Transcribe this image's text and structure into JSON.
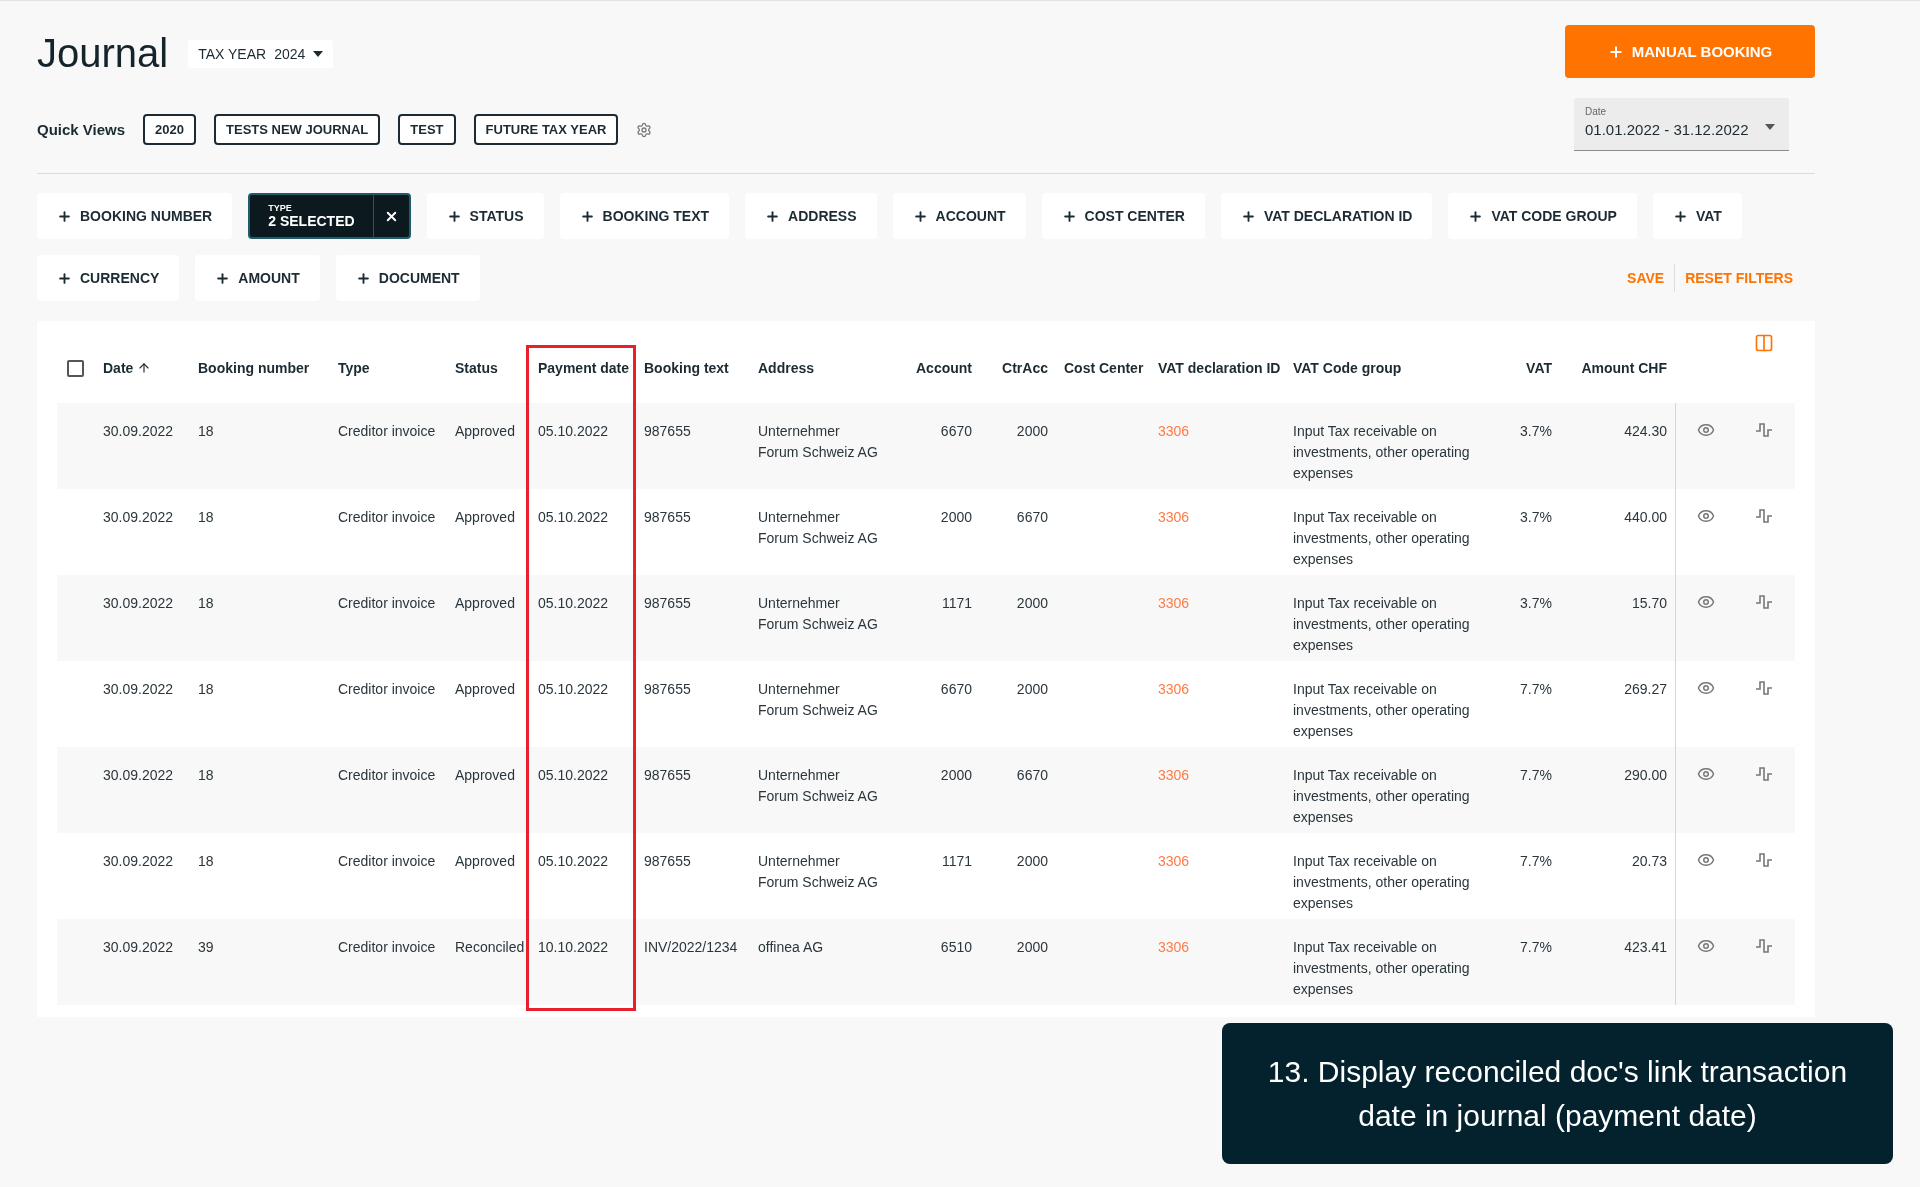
{
  "header": {
    "title": "Journal",
    "tax_year_label": "TAX YEAR",
    "tax_year": "2024",
    "action": "MANUAL BOOKING"
  },
  "quick_views": {
    "label": "Quick Views",
    "items": [
      "2020",
      "TESTS NEW JOURNAL",
      "TEST",
      "FUTURE TAX YEAR"
    ]
  },
  "date_filter": {
    "label": "Date",
    "value": "01.01.2022 - 31.12.2022"
  },
  "filters": [
    {
      "kind": "add",
      "label": "BOOKING NUMBER"
    },
    {
      "kind": "active",
      "caption": "TYPE",
      "label": "2 SELECTED"
    },
    {
      "kind": "add",
      "label": "STATUS"
    },
    {
      "kind": "add",
      "label": "BOOKING TEXT"
    },
    {
      "kind": "add",
      "label": "ADDRESS"
    },
    {
      "kind": "add",
      "label": "ACCOUNT"
    },
    {
      "kind": "add",
      "label": "COST CENTER"
    },
    {
      "kind": "add",
      "label": "VAT DECLARATION ID"
    },
    {
      "kind": "add",
      "label": "VAT CODE GROUP"
    },
    {
      "kind": "add",
      "label": "VAT"
    },
    {
      "kind": "add",
      "label": "CURRENCY"
    },
    {
      "kind": "add",
      "label": "AMOUNT"
    },
    {
      "kind": "add",
      "label": "DOCUMENT"
    }
  ],
  "filter_actions": [
    "SAVE",
    "RESET FILTERS"
  ],
  "table": {
    "select_all_checked": false,
    "columns": [
      {
        "label": "Date",
        "sorted": true,
        "highlighted": false
      },
      {
        "label": "Booking number",
        "sorted": false,
        "highlighted": false
      },
      {
        "label": "Type",
        "sorted": false,
        "highlighted": false
      },
      {
        "label": "Status",
        "sorted": false,
        "highlighted": false
      },
      {
        "label": "Payment date",
        "sorted": false,
        "highlighted": true
      },
      {
        "label": "Booking text",
        "sorted": false,
        "highlighted": false
      },
      {
        "label": "Address",
        "sorted": false,
        "highlighted": false
      },
      {
        "label": "Account",
        "sorted": false,
        "highlighted": false
      },
      {
        "label": "CtrAcc",
        "sorted": false,
        "highlighted": false
      },
      {
        "label": "Cost Center",
        "sorted": false,
        "highlighted": false
      },
      {
        "label": "VAT declaration ID",
        "sorted": false,
        "highlighted": false
      },
      {
        "label": "VAT Code group",
        "sorted": false,
        "highlighted": false
      },
      {
        "label": "VAT",
        "sorted": false,
        "highlighted": false
      },
      {
        "label": "Amount CHF",
        "sorted": false,
        "highlighted": false
      }
    ],
    "rows": [
      {
        "date": "30.09.2022",
        "booking_number": "18",
        "type": "Creditor invoice",
        "status": "Approved",
        "payment_date": "05.10.2022",
        "booking_text": "987655",
        "address": "Unternehmer Forum Schweiz AG",
        "account": "6670",
        "ctr_acc": "2000",
        "vat_declaration_id": "3306",
        "vat_code_group": "Input Tax receivable on investments, other operating expenses",
        "vat": "3.7%",
        "amount": "424.30"
      },
      {
        "date": "30.09.2022",
        "booking_number": "18",
        "type": "Creditor invoice",
        "status": "Approved",
        "payment_date": "05.10.2022",
        "booking_text": "987655",
        "address": "Unternehmer Forum Schweiz AG",
        "account": "2000",
        "ctr_acc": "6670",
        "vat_declaration_id": "3306",
        "vat_code_group": "Input Tax receivable on investments, other operating expenses",
        "vat": "3.7%",
        "amount": "440.00"
      },
      {
        "date": "30.09.2022",
        "booking_number": "18",
        "type": "Creditor invoice",
        "status": "Approved",
        "payment_date": "05.10.2022",
        "booking_text": "987655",
        "address": "Unternehmer Forum Schweiz AG",
        "account": "1171",
        "ctr_acc": "2000",
        "vat_declaration_id": "3306",
        "vat_code_group": "Input Tax receivable on investments, other operating expenses",
        "vat": "3.7%",
        "amount": "15.70"
      },
      {
        "date": "30.09.2022",
        "booking_number": "18",
        "type": "Creditor invoice",
        "status": "Approved",
        "payment_date": "05.10.2022",
        "booking_text": "987655",
        "address": "Unternehmer Forum Schweiz AG",
        "account": "6670",
        "ctr_acc": "2000",
        "vat_declaration_id": "3306",
        "vat_code_group": "Input Tax receivable on investments, other operating expenses",
        "vat": "7.7%",
        "amount": "269.27"
      },
      {
        "date": "30.09.2022",
        "booking_number": "18",
        "type": "Creditor invoice",
        "status": "Approved",
        "payment_date": "05.10.2022",
        "booking_text": "987655",
        "address": "Unternehmer Forum Schweiz AG",
        "account": "2000",
        "ctr_acc": "6670",
        "vat_declaration_id": "3306",
        "vat_code_group": "Input Tax receivable on investments, other operating expenses",
        "vat": "7.7%",
        "amount": "290.00"
      },
      {
        "date": "30.09.2022",
        "booking_number": "18",
        "type": "Creditor invoice",
        "status": "Approved",
        "payment_date": "05.10.2022",
        "booking_text": "987655",
        "address": "Unternehmer Forum Schweiz AG",
        "account": "1171",
        "ctr_acc": "2000",
        "vat_declaration_id": "3306",
        "vat_code_group": "Input Tax receivable on investments, other operating expenses",
        "vat": "7.7%",
        "amount": "20.73"
      },
      {
        "date": "30.09.2022",
        "booking_number": "39",
        "type": "Creditor invoice",
        "status": "Reconciled",
        "payment_date": "10.10.2022",
        "booking_text": "INV/2022/1234",
        "address": "offinea AG",
        "account": "6510",
        "ctr_acc": "2000",
        "vat_declaration_id": "3306",
        "vat_code_group": "Input Tax receivable on investments, other operating expenses",
        "vat": "7.7%",
        "amount": "423.41"
      }
    ]
  },
  "annotation": "13. Display reconciled doc's link transaction date in journal (payment date)"
}
